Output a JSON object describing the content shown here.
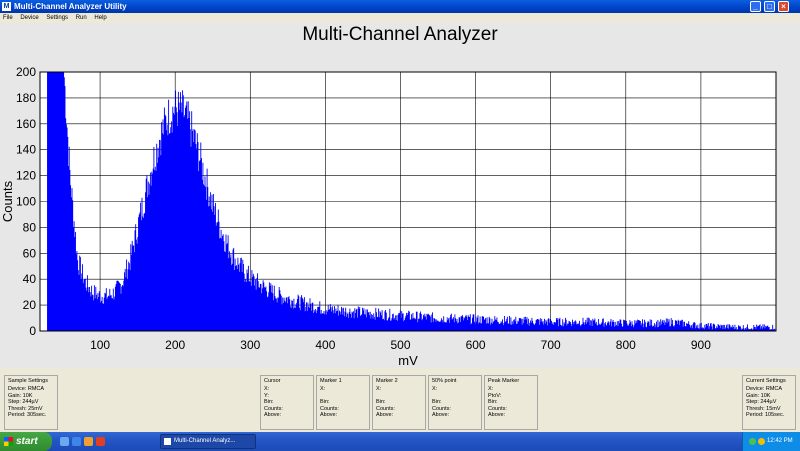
{
  "window": {
    "title": "Multi-Channel Analyzer Utility",
    "icon_letter": "M"
  },
  "menu": [
    "File",
    "Device",
    "Settings",
    "Run",
    "Help"
  ],
  "chart_data": {
    "type": "bar",
    "title": "Multi-Channel Analyzer",
    "xlabel": "mV",
    "ylabel": "Counts",
    "xlim": [
      20,
      1000
    ],
    "ylim": [
      0,
      200
    ],
    "xticks": [
      100,
      200,
      300,
      400,
      500,
      600,
      700,
      800,
      900
    ],
    "yticks": [
      0,
      20,
      40,
      60,
      80,
      100,
      120,
      140,
      160,
      180,
      200
    ],
    "grid": true,
    "color": "#0000ff",
    "series": [
      {
        "x": [
          30,
          45,
          52,
          60,
          70,
          80,
          90,
          100,
          110,
          120,
          130,
          140,
          150,
          160,
          170,
          180,
          190,
          200,
          210,
          220,
          230,
          240,
          250,
          260,
          270,
          280,
          290,
          300,
          320,
          340,
          360,
          380,
          400,
          450,
          500,
          550,
          600,
          650,
          700,
          750,
          800,
          850,
          860,
          900,
          950,
          1000
        ],
        "y": [
          200,
          200,
          200,
          120,
          55,
          38,
          30,
          27,
          27,
          30,
          38,
          55,
          80,
          105,
          130,
          150,
          165,
          172,
          170,
          158,
          140,
          118,
          97,
          80,
          66,
          55,
          47,
          41,
          33,
          27,
          23,
          20,
          17,
          14,
          12,
          10,
          9,
          8,
          7,
          7,
          6,
          6,
          7,
          4,
          3,
          3
        ]
      }
    ]
  },
  "panels": [
    {
      "title": "Sample Settings",
      "lines": [
        "Device: RMCA",
        "Gain: 10K",
        "Step: 244µV",
        "Thresh: 25mV",
        "Period: 305sec."
      ]
    },
    {
      "title": "Cursor",
      "lines": [
        "X:",
        "Y:",
        "Bin:",
        "Counts:",
        "Above:"
      ]
    },
    {
      "title": "Marker 1",
      "lines": [
        "X:",
        "",
        "Bin:",
        "Counts:",
        "Above:"
      ]
    },
    {
      "title": "Marker 2",
      "lines": [
        "X:",
        "",
        "Bin:",
        "Counts:",
        "Above:"
      ]
    },
    {
      "title": "50% point",
      "lines": [
        "X:",
        "",
        "Bin:",
        "Counts:",
        "Above:"
      ]
    },
    {
      "title": "Peak Marker",
      "lines": [
        "X:",
        "PtoV:",
        "Bin:",
        "Counts:",
        "Above:"
      ]
    },
    {
      "title": "Current Settings",
      "lines": [
        "Device: RMCA",
        "Gain: 10K",
        "Step: 244µV",
        "Thresh: 15mV",
        "Period: 105sec."
      ]
    }
  ],
  "taskbar": {
    "start": "start",
    "task": "Multi-Channel Analyz...",
    "clock": "12:42 PM"
  }
}
